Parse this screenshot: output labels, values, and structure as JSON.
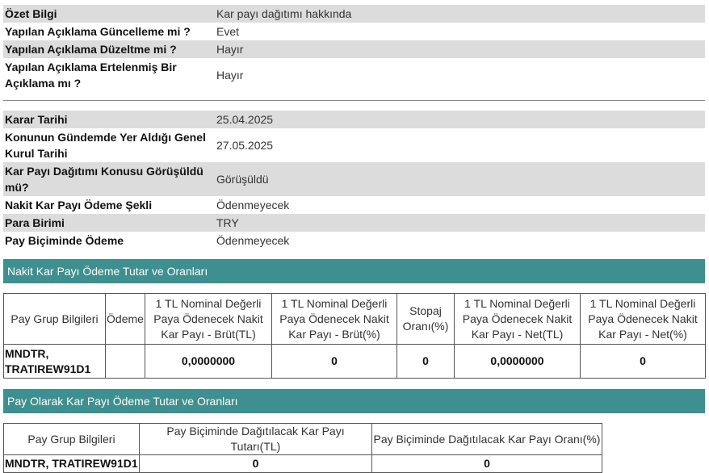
{
  "summary": [
    {
      "label": "Özet Bilgi",
      "value": "Kar payı dağıtımı hakkında"
    },
    {
      "label": "Yapılan Açıklama Güncelleme mi ?",
      "value": "Evet"
    },
    {
      "label": "Yapılan Açıklama Düzeltme mi ?",
      "value": "Hayır"
    },
    {
      "label": "Yapılan Açıklama Ertelenmiş Bir Açıklama mı ?",
      "value": "Hayır"
    }
  ],
  "details": [
    {
      "label": "Karar Tarihi",
      "value": "25.04.2025"
    },
    {
      "label": "Konunun Gündemde Yer Aldığı Genel Kurul Tarihi",
      "value": "27.05.2025"
    },
    {
      "label": "Kar Payı Dağıtımı Konusu Görüşüldü mü?",
      "value": "Görüşüldü"
    },
    {
      "label": "Nakit Kar Payı Ödeme Şekli",
      "value": "Ödenmeyecek"
    },
    {
      "label": "Para Birimi",
      "value": "TRY"
    },
    {
      "label": "Pay Biçiminde Ödeme",
      "value": "Ödenmeyecek"
    }
  ],
  "cash_section": {
    "title": "Nakit Kar Payı Ödeme Tutar ve Oranları",
    "headers": [
      "Pay Grup Bilgileri",
      "Ödeme",
      "1 TL Nominal Değerli Paya Ödenecek Nakit Kar Payı - Brüt(TL)",
      "1 TL Nominal Değerli Paya Ödenecek Nakit Kar Payı - Brüt(%)",
      "Stopaj Oranı(%)",
      "1 TL Nominal Değerli Paya Ödenecek Nakit Kar Payı - Net(TL)",
      "1 TL Nominal Değerli Paya Ödenecek Nakit Kar Payı - Net(%)"
    ],
    "row": [
      "MNDTR, TRATIREW91D1",
      "",
      "0,0000000",
      "0",
      "0",
      "0,0000000",
      "0"
    ]
  },
  "share_section": {
    "title": "Pay Olarak Kar Payı Ödeme Tutar ve Oranları",
    "headers": [
      "Pay Grup Bilgileri",
      "Pay Biçiminde Dağıtılacak Kar Payı Tutarı(TL)",
      "Pay Biçiminde Dağıtılacak Kar Payı Oranı(%)"
    ],
    "row": [
      "MNDTR, TRATIREW91D1",
      "0",
      "0"
    ]
  }
}
